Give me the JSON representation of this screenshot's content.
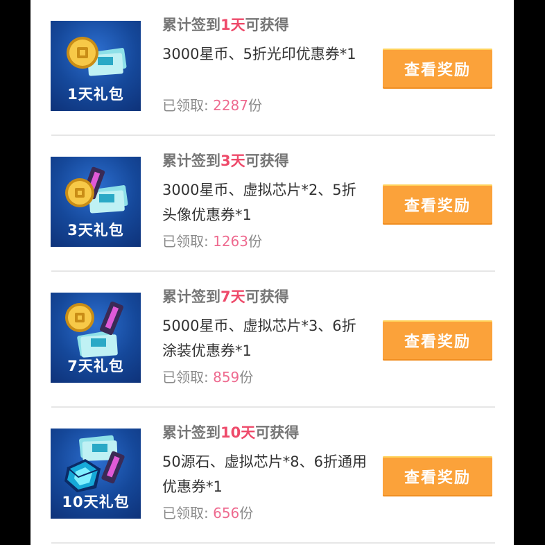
{
  "rows": [
    {
      "thumb_label": "1天礼包",
      "title_prefix": "累计签到",
      "title_days": "1天",
      "title_suffix": "可获得",
      "description": "3000星币、5折光印优惠券*1",
      "claimed_prefix": "已领取: ",
      "claimed_count": "2287",
      "claimed_suffix": "份",
      "button_label": "查看奖励",
      "icons": [
        "gold-coin-icon",
        "coupon-ticket-icon"
      ]
    },
    {
      "thumb_label": "3天礼包",
      "title_prefix": "累计签到",
      "title_days": "3天",
      "title_suffix": "可获得",
      "description": "3000星币、虚拟芯片*2、5折头像优惠券*1",
      "claimed_prefix": "已领取: ",
      "claimed_count": "1263",
      "claimed_suffix": "份",
      "button_label": "查看奖励",
      "icons": [
        "gold-coin-icon",
        "chip-icon",
        "coupon-ticket-icon"
      ]
    },
    {
      "thumb_label": "7天礼包",
      "title_prefix": "累计签到",
      "title_days": "7天",
      "title_suffix": "可获得",
      "description": "5000星币、虚拟芯片*3、6折涂装优惠券*1",
      "claimed_prefix": "已领取: ",
      "claimed_count": "859",
      "claimed_suffix": "份",
      "button_label": "查看奖励",
      "icons": [
        "gold-coin-icon",
        "chip-icon",
        "coupon-ticket-icon"
      ]
    },
    {
      "thumb_label": "10天礼包",
      "title_prefix": "累计签到",
      "title_days": "10天",
      "title_suffix": "可获得",
      "description": "50源石、虚拟芯片*8、6折通用优惠券*1",
      "claimed_prefix": "已领取: ",
      "claimed_count": "656",
      "claimed_suffix": "份",
      "button_label": "查看奖励",
      "icons": [
        "source-stone-icon",
        "chip-icon",
        "coupon-ticket-icon"
      ]
    }
  ],
  "colors": {
    "highlight": "#ee4a6a",
    "count": "#ee6a8f",
    "button": "#fba23a",
    "thumb_bg": "#15489a"
  }
}
